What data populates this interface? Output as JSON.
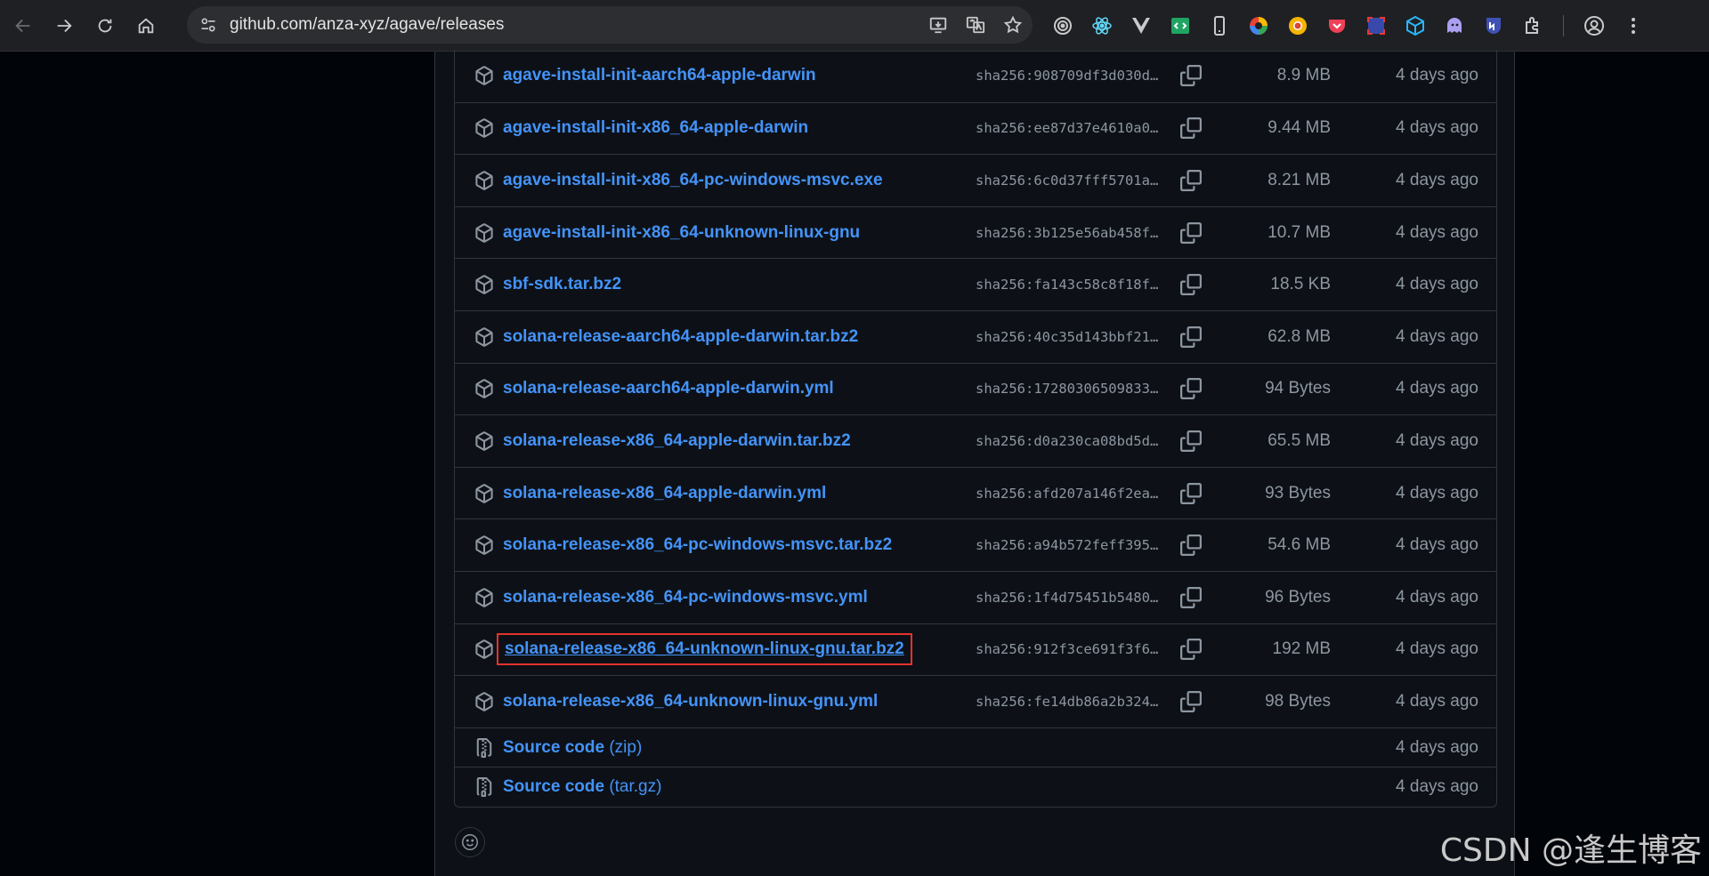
{
  "browser": {
    "url": "github.com/anza-xyz/agave/releases"
  },
  "assets": [
    {
      "name": "agave-install-init-aarch64-apple-darwin",
      "sha": "sha256:908709df3d030d…",
      "size": "8.9 MB",
      "date": "4 days ago"
    },
    {
      "name": "agave-install-init-x86_64-apple-darwin",
      "sha": "sha256:ee87d37e4610a0…",
      "size": "9.44 MB",
      "date": "4 days ago"
    },
    {
      "name": "agave-install-init-x86_64-pc-windows-msvc.exe",
      "sha": "sha256:6c0d37fff5701a…",
      "size": "8.21 MB",
      "date": "4 days ago"
    },
    {
      "name": "agave-install-init-x86_64-unknown-linux-gnu",
      "sha": "sha256:3b125e56ab458f…",
      "size": "10.7 MB",
      "date": "4 days ago"
    },
    {
      "name": "sbf-sdk.tar.bz2",
      "sha": "sha256:fa143c58c8f18f…",
      "size": "18.5 KB",
      "date": "4 days ago"
    },
    {
      "name": "solana-release-aarch64-apple-darwin.tar.bz2",
      "sha": "sha256:40c35d143bbf21…",
      "size": "62.8 MB",
      "date": "4 days ago"
    },
    {
      "name": "solana-release-aarch64-apple-darwin.yml",
      "sha": "sha256:17280306509833…",
      "size": "94 Bytes",
      "date": "4 days ago"
    },
    {
      "name": "solana-release-x86_64-apple-darwin.tar.bz2",
      "sha": "sha256:d0a230ca08bd5d…",
      "size": "65.5 MB",
      "date": "4 days ago"
    },
    {
      "name": "solana-release-x86_64-apple-darwin.yml",
      "sha": "sha256:afd207a146f2ea…",
      "size": "93 Bytes",
      "date": "4 days ago"
    },
    {
      "name": "solana-release-x86_64-pc-windows-msvc.tar.bz2",
      "sha": "sha256:a94b572feff395…",
      "size": "54.6 MB",
      "date": "4 days ago"
    },
    {
      "name": "solana-release-x86_64-pc-windows-msvc.yml",
      "sha": "sha256:1f4d75451b5480…",
      "size": "96 Bytes",
      "date": "4 days ago"
    },
    {
      "name": "solana-release-x86_64-unknown-linux-gnu.tar.bz2",
      "sha": "sha256:912f3ce691f3f6…",
      "size": "192 MB",
      "date": "4 days ago"
    },
    {
      "name": "solana-release-x86_64-unknown-linux-gnu.yml",
      "sha": "sha256:fe14db86a2b324…",
      "size": "98 Bytes",
      "date": "4 days ago"
    }
  ],
  "source": [
    {
      "label": "Source code",
      "format": "(zip)",
      "date": "4 days ago"
    },
    {
      "label": "Source code",
      "format": "(tar.gz)",
      "date": "4 days ago"
    }
  ],
  "watermark": "CSDN @逢生博客",
  "colors": {
    "link": "#4493f8",
    "muted": "#8d96a0",
    "border": "#30363d",
    "highlight": "#e5322d"
  }
}
